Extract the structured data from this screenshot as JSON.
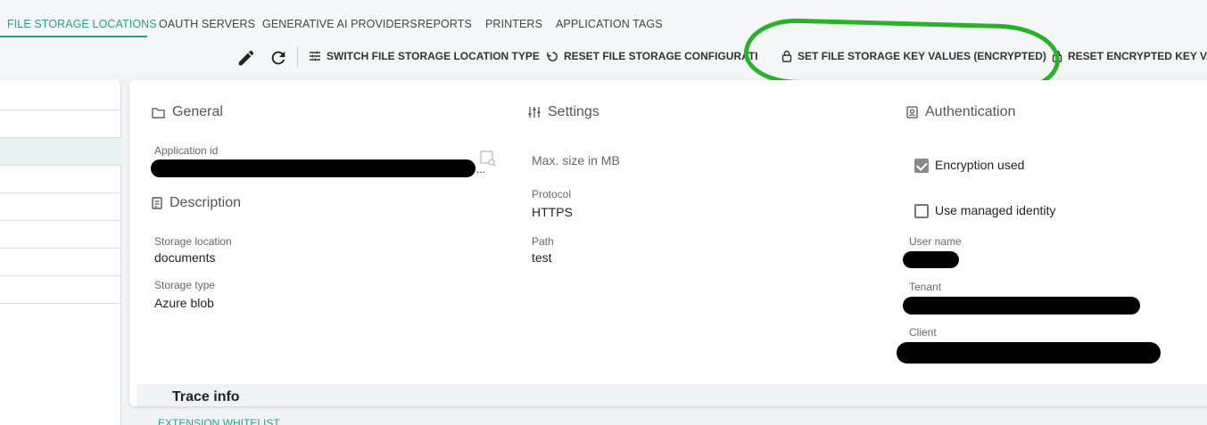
{
  "tabs": [
    {
      "label": "FILE STORAGE LOCATIONS",
      "active": true
    },
    {
      "label": "OAUTH SERVERS"
    },
    {
      "label": "GENERATIVE AI PROVIDERS"
    },
    {
      "label": "REPORTS"
    },
    {
      "label": "PRINTERS"
    },
    {
      "label": "APPLICATION TAGS"
    }
  ],
  "toolbar": {
    "edit_icon": "pencil-icon",
    "refresh_icon": "refresh-icon",
    "switch_type": "SWITCH FILE STORAGE LOCATION TYPE",
    "reset_config": "RESET FILE STORAGE CONFIGURATI",
    "set_key_values": "SET FILE STORAGE KEY VALUES (ENCRYPTED)",
    "reset_encrypted": "RESET ENCRYPTED KEY VAL"
  },
  "general": {
    "title": "General",
    "app_id_label": "Application id",
    "app_id_more": "...",
    "description_title": "Description",
    "storage_location_label": "Storage location",
    "storage_location_value": "documents",
    "storage_type_label": "Storage type",
    "storage_type_value": "Azure blob"
  },
  "settings": {
    "title": "Settings",
    "max_size_placeholder": "Max. size in MB",
    "protocol_label": "Protocol",
    "protocol_value": "HTTPS",
    "path_label": "Path",
    "path_value": "test"
  },
  "authentication": {
    "title": "Authentication",
    "encryption_used_label": "Encryption used",
    "encryption_used": true,
    "use_managed_identity_label": "Use managed identity",
    "use_managed_identity": false,
    "user_name_label": "User name",
    "tenant_label": "Tenant",
    "client_label": "Client"
  },
  "trace": {
    "title": "Trace info"
  },
  "extension_whitelist": "EXTENSION WHITELIST",
  "colors": {
    "accent": "#2a9c8a",
    "annotation": "#2bb02b",
    "selected_row": "#e7f3f0"
  }
}
